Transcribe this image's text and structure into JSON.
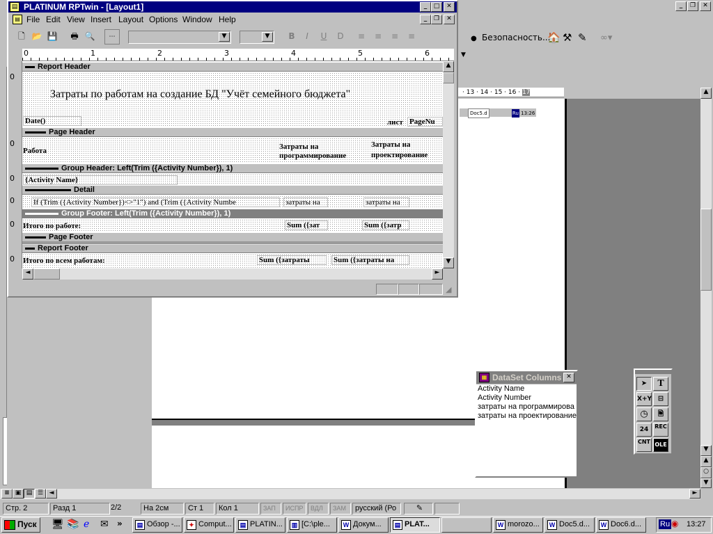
{
  "rptwin": {
    "title": "PLATINUM RPTwin - [Layout1]",
    "menu": [
      "File",
      "Edit",
      "View",
      "Insert",
      "Layout",
      "Options",
      "Window",
      "Help"
    ],
    "ruler_numbers": [
      "0",
      "1",
      "2",
      "3",
      "4",
      "5",
      "6"
    ],
    "bands": {
      "report_header": "Report Header",
      "page_header": "Page Header",
      "group_header": "Group Header: Left(Trim ({Activity Number}), 1)",
      "detail": "Detail",
      "group_footer": "Group Footer: Left(Trim ({Activity Number}), 1)",
      "page_footer": "Page Footer",
      "report_footer": "Report Footer"
    },
    "report_title": "Затраты по работам на создание БД \"Учёт семейного бюджета\"",
    "date_field": "Date()",
    "sheet_label": "лист",
    "page_field": "PageNu",
    "col_work": "Работа",
    "col_prog_1": "Затраты на",
    "col_prog_2": "программирование",
    "col_proj_1": "Затраты на",
    "col_proj_2": "проектирование",
    "activity_name_field": "{Activity Name}",
    "detail_formula": "If (Trim ({Activity Number})<>\"1\") and (Trim ({Activity Numbe",
    "detail_field_1": "затраты на",
    "detail_field_2": "затраты на",
    "group_total_label": "Итого по работе:",
    "group_sum_1": "Sum ({зат",
    "group_sum_2": "Sum ({затр",
    "grand_total_label": "Итого по всем работам:",
    "grand_sum_1": "Sum ({затраты",
    "grand_sum_2": "Sum ({затраты на"
  },
  "word": {
    "security_label": "Безопасность...",
    "ruler_numbers": [
      "13",
      "14",
      "15",
      "16",
      "17"
    ],
    "thumb_1": "Doc5.d",
    "thumb_2": "Ru",
    "thumb_time": "13:26"
  },
  "dataset": {
    "title": "DataSet Columns",
    "items": [
      "Activity Name",
      "Activity Number",
      "затраты на программирова",
      "затраты на проектирование"
    ]
  },
  "toolbox": {
    "labels": [
      "X+Y",
      "REC",
      "CNT"
    ]
  },
  "statusbar": {
    "page": "Стр. 2",
    "section": "Разд 1",
    "pages": "2/2",
    "at": "На 2см",
    "line": "Ст 1",
    "col": "Кол 1",
    "rec": "ЗАП",
    "trk": "ИСПР",
    "ext": "ВДЛ",
    "ovr": "ЗАМ",
    "lang": "русский (Ро"
  },
  "taskbar": {
    "start": "Пуск",
    "tasks": [
      "Обзор -...",
      "Comput...",
      "PLATIN...",
      "[C:\\ple...",
      "Докум...",
      "PLAT...",
      "",
      "morozo...",
      "Doc5.d...",
      "Doc6.d..."
    ],
    "lang": "Ru",
    "clock": "13:27"
  }
}
